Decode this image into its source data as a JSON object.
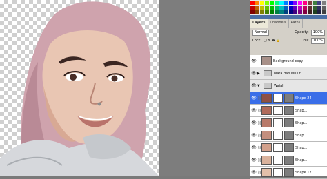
{
  "panel": {
    "tabs": [
      "Layers",
      "Channels",
      "Paths"
    ],
    "blend_mode": "Normal",
    "opacity_label": "Opacity:",
    "opacity_value": "100%",
    "lock_label": "Lock:",
    "fill_label": "Fill:",
    "fill_value": "100%"
  },
  "layers": [
    {
      "name": "Background copy",
      "type": "image",
      "color": "#a89088"
    },
    {
      "name": "Mata dan Mulut",
      "type": "group"
    },
    {
      "name": "Wajah",
      "type": "group"
    },
    {
      "name": "Shape 24",
      "type": "shape",
      "color": "#8e4f45",
      "selected": true
    },
    {
      "name": "Shap...",
      "type": "shape",
      "color": "#b06a5a"
    },
    {
      "name": "Shap...",
      "type": "shape",
      "color": "#b97a6a"
    },
    {
      "name": "Shap...",
      "type": "shape",
      "color": "#c48f7e"
    },
    {
      "name": "Shap...",
      "type": "shape",
      "color": "#d3a18c"
    },
    {
      "name": "Shap...",
      "type": "shape",
      "color": "#dab29c"
    },
    {
      "name": "Shape 12",
      "type": "shape",
      "color": "#e2c0aa"
    }
  ],
  "colors": {
    "hijab": "#cfa3ad",
    "hijab_dark": "#b98a96",
    "skin": "#e9c6b3",
    "skin_shadow": "#d8a994",
    "clothing": "#d6d8dc",
    "selection": "#3a6ee8"
  }
}
